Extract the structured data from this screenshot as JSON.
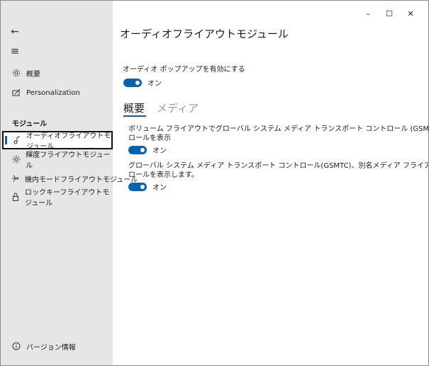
{
  "window": {
    "controls": {
      "minimize": "–",
      "maximize": "☐",
      "close": "✕"
    }
  },
  "sidebar": {
    "back_glyph": "←",
    "menu_glyph": "≡",
    "top_items": [
      {
        "label": "概要",
        "icon": "gear-icon"
      },
      {
        "label": "Personalization",
        "icon": "personalize-icon"
      }
    ],
    "section_header": "モジュール",
    "modules": [
      {
        "label": "オーディオフライアウトモジュール",
        "icon": "audio-icon",
        "selected": true
      },
      {
        "label": "輝度フライアウトモジュール",
        "icon": "brightness-icon",
        "selected": false
      },
      {
        "label": "機内モードフライアウトモジュール",
        "icon": "airplane-icon",
        "selected": false
      },
      {
        "label": "ロックキーフライアウトモジュール",
        "icon": "lock-icon",
        "selected": false
      }
    ],
    "footer": {
      "label": "バージョン情報",
      "icon": "info-icon"
    }
  },
  "main": {
    "title": "オーディオフライアウトモジュール",
    "popup_setting": {
      "label": "オーディオ ポップアップを有効にする",
      "state": "オン"
    },
    "tabs": [
      {
        "label": "概要",
        "active": true
      },
      {
        "label": "メディア",
        "active": false
      }
    ],
    "settings": [
      {
        "line1": "ボリューム フライアウトでグローバル システム メディア トランスポート コントロール (GSMTC) 別名メディア コント",
        "line2": "ロールを表示",
        "state": "オン"
      },
      {
        "line1": "グローバル システム メディア トランスポート コントロール(GSMTC)、別名メディア フライアウトでボリューム コント",
        "line2": "ロールを表示します。",
        "state": "オン"
      }
    ]
  }
}
